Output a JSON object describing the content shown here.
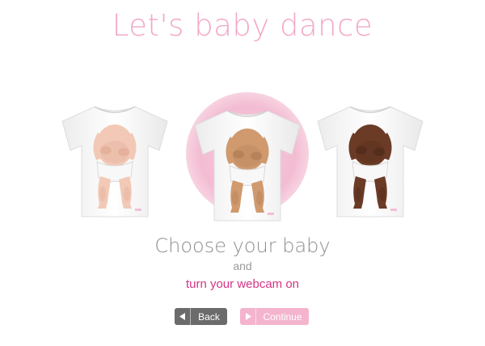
{
  "header": {
    "title": "Let's baby dance"
  },
  "babies": [
    {
      "skin": "#f2c9b6",
      "shade": "#dca58f"
    },
    {
      "skin": "#d09a6e",
      "shade": "#a87650"
    },
    {
      "skin": "#6b3b26",
      "shade": "#4a2616"
    }
  ],
  "prompt": {
    "choose": "Choose your baby",
    "and": "and",
    "webcam": "turn your webcam on"
  },
  "buttons": {
    "back_label": "Back",
    "continue_label": "Continue"
  },
  "colors": {
    "title": "#f2a8c8",
    "accent": "#d63384",
    "back_bg": "#6b6b6b",
    "continue_bg": "#f4b4cd"
  }
}
